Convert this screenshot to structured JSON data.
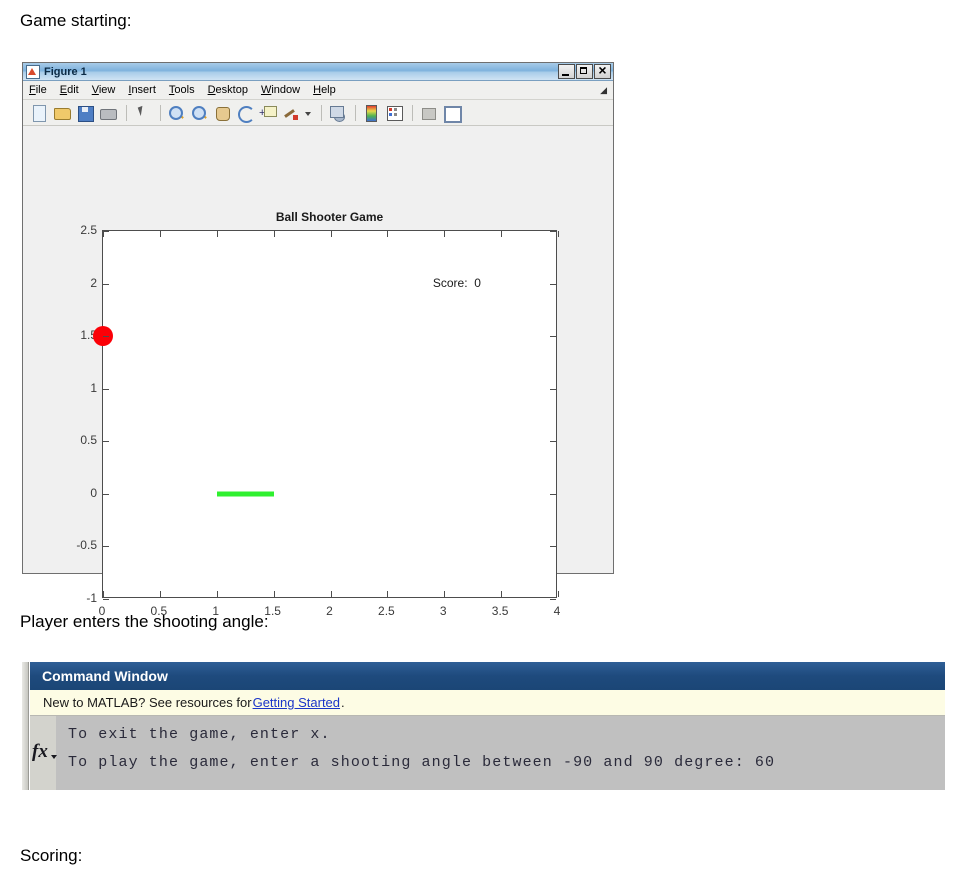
{
  "captions": {
    "game_starting": "Game starting:",
    "player_angle": "Player enters the shooting angle:",
    "scoring": "Scoring:"
  },
  "figure_window": {
    "title": "Figure 1",
    "window_controls": {
      "minimize": "Minimize",
      "maximize": "Maximize",
      "close": "Close"
    },
    "menus": [
      {
        "mnemonic": "F",
        "rest": "ile"
      },
      {
        "mnemonic": "E",
        "rest": "dit"
      },
      {
        "mnemonic": "V",
        "rest": "iew"
      },
      {
        "mnemonic": "I",
        "rest": "nsert"
      },
      {
        "mnemonic": "T",
        "rest": "ools"
      },
      {
        "mnemonic": "D",
        "rest": "esktop"
      },
      {
        "mnemonic": "W",
        "rest": "indow"
      },
      {
        "mnemonic": "H",
        "rest": "elp"
      }
    ],
    "toolbar": [
      "new-figure",
      "open-file",
      "save-figure",
      "print-figure",
      "edit-plot-pointer",
      "zoom-in",
      "zoom-out",
      "pan",
      "rotate-3d",
      "data-cursor",
      "brush-data",
      "link-plot",
      "colorbar",
      "legend",
      "hide-plot-tools",
      "show-plot-tools"
    ]
  },
  "chart_data": {
    "type": "scatter",
    "title": "Ball Shooter Game",
    "xlabel": "",
    "ylabel": "",
    "xlim": [
      0,
      4
    ],
    "ylim": [
      -1,
      2.5
    ],
    "xticks": [
      "0",
      "0.5",
      "1",
      "1.5",
      "2",
      "2.5",
      "3",
      "3.5",
      "4"
    ],
    "xtick_values": [
      0,
      0.5,
      1,
      1.5,
      2,
      2.5,
      3,
      3.5,
      4
    ],
    "yticks": [
      "2.5",
      "2",
      "1.5",
      "1",
      "0.5",
      "0",
      "-0.5",
      "-1"
    ],
    "ytick_values": [
      2.5,
      2,
      1.5,
      1,
      0.5,
      0,
      -0.5,
      -1
    ],
    "grid": false,
    "legend": false,
    "annotations": [
      {
        "name": "score",
        "text": "Score:  0",
        "x": 2.9,
        "y": 2.0
      }
    ],
    "series": [
      {
        "name": "ball",
        "type": "marker",
        "marker": "o",
        "color": "#fb0007",
        "size": 20,
        "x": [
          0
        ],
        "y": [
          1.5
        ]
      },
      {
        "name": "paddle",
        "type": "line",
        "color": "#2ff02f",
        "linewidth": 5,
        "x": [
          1,
          1.5
        ],
        "y": [
          0,
          0
        ]
      }
    ]
  },
  "command_window": {
    "title": "Command Window",
    "notice": {
      "before": "New to MATLAB? See resources for ",
      "link": "Getting Started",
      "after": "."
    },
    "fx_icon": "fx",
    "lines": [
      "To exit the game, enter x.",
      "To play the game, enter a shooting angle between -90 and 90 degree: 60"
    ]
  }
}
